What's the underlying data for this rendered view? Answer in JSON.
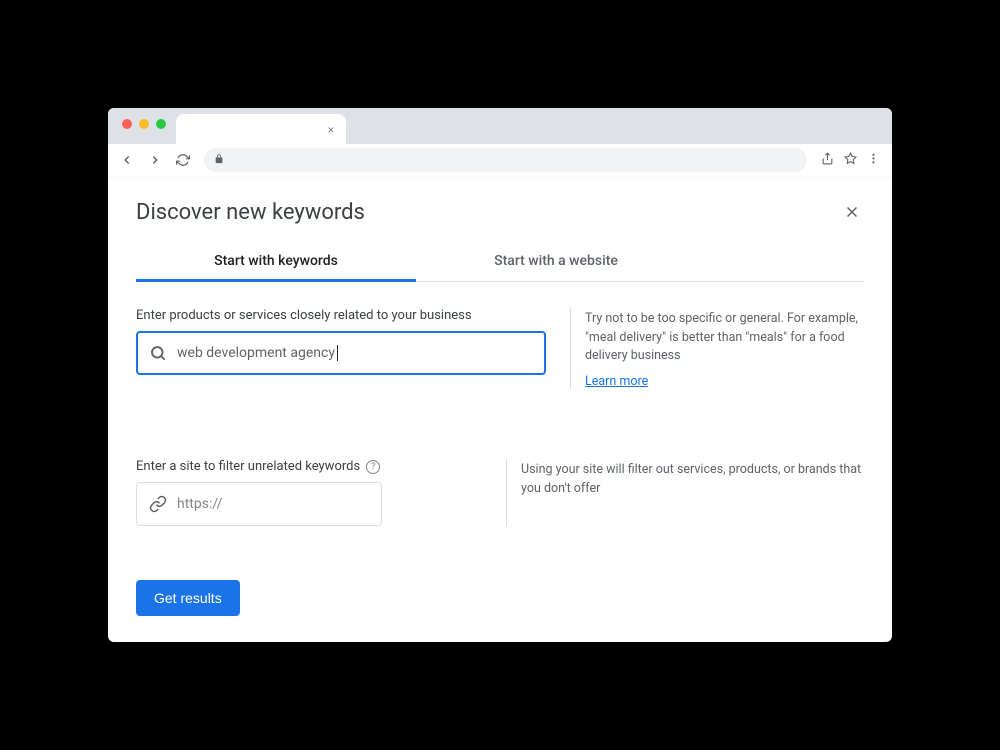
{
  "page": {
    "title": "Discover new keywords"
  },
  "tabs": [
    {
      "label": "Start with keywords",
      "active": true
    },
    {
      "label": "Start with a website",
      "active": false
    }
  ],
  "keyword_field": {
    "label": "Enter products or services closely related to your business",
    "value": "web development agency",
    "help_text": "Try not to be too specific or general. For example, \"meal delivery\" is better than \"meals\" for a food delivery business",
    "learn_more": "Learn more"
  },
  "site_field": {
    "label": "Enter a site to filter unrelated keywords",
    "placeholder": "https://",
    "help_text": "Using your site will filter out services, products, or brands that you don't offer"
  },
  "submit": {
    "label": "Get results"
  }
}
